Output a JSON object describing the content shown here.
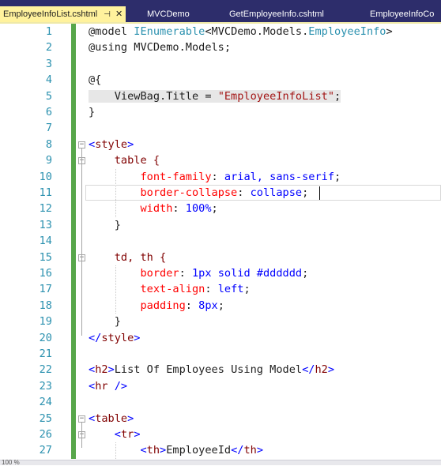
{
  "tabs": [
    {
      "label": "EmployeeInfoList.cshtml",
      "active": true,
      "pin": "⊣",
      "close": "✕"
    },
    {
      "label": "MVCDemo",
      "active": false
    },
    {
      "label": "GetEmployeeInfo.cshtml",
      "active": false
    },
    {
      "label": "EmployeeInfoCo",
      "active": false
    }
  ],
  "status": {
    "zoom": "100 %"
  },
  "lines": [
    {
      "n": "1",
      "tokens": [
        [
          "@model",
          "razor"
        ],
        [
          " ",
          "plain"
        ],
        [
          "IEnumerable",
          "type"
        ],
        [
          "<MVCDemo.Models.",
          "plain"
        ],
        [
          "EmployeeInfo",
          "type"
        ],
        [
          ">",
          "plain"
        ]
      ]
    },
    {
      "n": "2",
      "tokens": [
        [
          "@using",
          "razor"
        ],
        [
          " MVCDemo.Models;",
          "plain"
        ]
      ]
    },
    {
      "n": "3",
      "tokens": []
    },
    {
      "n": "4",
      "tokens": [
        [
          "@{",
          "razor"
        ]
      ]
    },
    {
      "n": "5",
      "tokens": [
        [
          "    ViewBag.Title = ",
          "plain"
        ],
        [
          "\"EmployeeInfoList\"",
          "str"
        ],
        [
          ";",
          "plain"
        ]
      ]
    },
    {
      "n": "6",
      "tokens": [
        [
          "}",
          "razor"
        ]
      ]
    },
    {
      "n": "7",
      "tokens": []
    },
    {
      "n": "8",
      "tokens": [
        [
          "<",
          "br"
        ],
        [
          "style",
          "tag"
        ],
        [
          ">",
          "br"
        ]
      ]
    },
    {
      "n": "9",
      "tokens": [
        [
          "    table {",
          "tag"
        ]
      ]
    },
    {
      "n": "10",
      "tokens": [
        [
          "        ",
          "plain"
        ],
        [
          "font-family",
          "attr"
        ],
        [
          ": ",
          "plain"
        ],
        [
          "arial, sans-serif",
          "val"
        ],
        [
          ";",
          "plain"
        ]
      ]
    },
    {
      "n": "11",
      "tokens": [
        [
          "        ",
          "plain"
        ],
        [
          "border-collapse",
          "attr"
        ],
        [
          ": ",
          "plain"
        ],
        [
          "collapse",
          "val"
        ],
        [
          ";",
          "plain"
        ]
      ]
    },
    {
      "n": "12",
      "tokens": [
        [
          "        ",
          "plain"
        ],
        [
          "width",
          "attr"
        ],
        [
          ": ",
          "plain"
        ],
        [
          "100%",
          "val"
        ],
        [
          ";",
          "plain"
        ]
      ]
    },
    {
      "n": "13",
      "tokens": [
        [
          "    }",
          "plain"
        ]
      ]
    },
    {
      "n": "14",
      "tokens": []
    },
    {
      "n": "15",
      "tokens": [
        [
          "    td, th {",
          "tag"
        ]
      ]
    },
    {
      "n": "16",
      "tokens": [
        [
          "        ",
          "plain"
        ],
        [
          "border",
          "attr"
        ],
        [
          ": ",
          "plain"
        ],
        [
          "1px solid #dddddd",
          "val"
        ],
        [
          ";",
          "plain"
        ]
      ]
    },
    {
      "n": "17",
      "tokens": [
        [
          "        ",
          "plain"
        ],
        [
          "text-align",
          "attr"
        ],
        [
          ": ",
          "plain"
        ],
        [
          "left",
          "val"
        ],
        [
          ";",
          "plain"
        ]
      ]
    },
    {
      "n": "18",
      "tokens": [
        [
          "        ",
          "plain"
        ],
        [
          "padding",
          "attr"
        ],
        [
          ": ",
          "plain"
        ],
        [
          "8px",
          "val"
        ],
        [
          ";",
          "plain"
        ]
      ]
    },
    {
      "n": "19",
      "tokens": [
        [
          "    }",
          "plain"
        ]
      ]
    },
    {
      "n": "20",
      "tokens": [
        [
          "</",
          "br"
        ],
        [
          "style",
          "tag"
        ],
        [
          ">",
          "br"
        ]
      ]
    },
    {
      "n": "21",
      "tokens": []
    },
    {
      "n": "22",
      "tokens": [
        [
          "<",
          "br"
        ],
        [
          "h2",
          "tag"
        ],
        [
          ">",
          "br"
        ],
        [
          "List Of Employees Using Model",
          "plain"
        ],
        [
          "</",
          "br"
        ],
        [
          "h2",
          "tag"
        ],
        [
          ">",
          "br"
        ]
      ]
    },
    {
      "n": "23",
      "tokens": [
        [
          "<",
          "br"
        ],
        [
          "hr",
          "tag"
        ],
        [
          " />",
          "br"
        ]
      ]
    },
    {
      "n": "24",
      "tokens": []
    },
    {
      "n": "25",
      "tokens": [
        [
          "<",
          "br"
        ],
        [
          "table",
          "tag"
        ],
        [
          ">",
          "br"
        ]
      ]
    },
    {
      "n": "26",
      "tokens": [
        [
          "    ",
          "plain"
        ],
        [
          "<",
          "br"
        ],
        [
          "tr",
          "tag"
        ],
        [
          ">",
          "br"
        ]
      ]
    },
    {
      "n": "27",
      "tokens": [
        [
          "        ",
          "plain"
        ],
        [
          "<",
          "br"
        ],
        [
          "th",
          "tag"
        ],
        [
          ">",
          "br"
        ],
        [
          "EmployeeId",
          "plain"
        ],
        [
          "</",
          "br"
        ],
        [
          "th",
          "tag"
        ],
        [
          ">",
          "br"
        ]
      ]
    }
  ]
}
